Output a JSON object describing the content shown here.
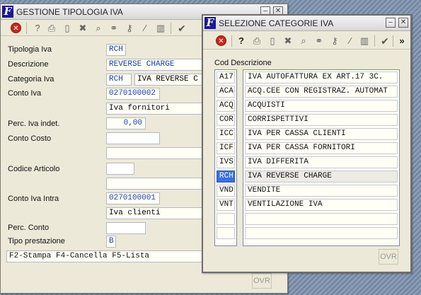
{
  "main_window": {
    "title": "GESTIONE TIPOLOGIA IVA",
    "form": {
      "tipologia": {
        "label": "Tipologia Iva",
        "value": "RCH"
      },
      "descrizione": {
        "label": "Descrizione",
        "value": "REVERSE CHARGE"
      },
      "categoria": {
        "label": "Categoria Iva",
        "code": "RCH",
        "desc": "IVA REVERSE C"
      },
      "conto_iva": {
        "label": "Conto Iva",
        "code": "0270100002",
        "desc": "Iva fornitori"
      },
      "perc_indet": {
        "label": "Perc. Iva indet.",
        "value": "0,00"
      },
      "conto_costo": {
        "label": "Conto Costo",
        "code": "",
        "desc": ""
      },
      "codice_articolo": {
        "label": "Codice Articolo",
        "code": "",
        "desc": ""
      },
      "conto_intra": {
        "label": "Conto Iva Intra",
        "code": "0270100001",
        "desc": "Iva clienti"
      },
      "perc_conto": {
        "label": "Perc. Conto",
        "value": ""
      },
      "tipo_prestazione": {
        "label": "Tipo prestazione",
        "value": "B"
      }
    },
    "status_text": "F2-Stampa F4-Cancella F5-Lista",
    "ovr_label": "OVR"
  },
  "popup": {
    "title": "SELEZIONE CATEGORIE IVA",
    "header_label": "Cod Descrizione",
    "rows": [
      {
        "code": "A17",
        "desc": "IVA AUTOFATTURA EX ART.17 3C."
      },
      {
        "code": "ACA",
        "desc": "ACQ.CEE CON REGISTRAZ. AUTOMAT"
      },
      {
        "code": "ACQ",
        "desc": "ACQUISTI"
      },
      {
        "code": "COR",
        "desc": "CORRISPETTIVI"
      },
      {
        "code": "ICC",
        "desc": "IVA PER CASSA CLIENTI"
      },
      {
        "code": "ICF",
        "desc": "IVA PER CASSA FORNITORI"
      },
      {
        "code": "IVS",
        "desc": "IVA DIFFERITA"
      },
      {
        "code": "RCH",
        "desc": "IVA REVERSE CHARGE"
      },
      {
        "code": "VND",
        "desc": "VENDITE"
      },
      {
        "code": "VNT",
        "desc": "VENTILAZIONE IVA"
      },
      {
        "code": "",
        "desc": ""
      },
      {
        "code": "",
        "desc": ""
      }
    ],
    "selected_index": 7,
    "more_label": "»",
    "ovr_label": "OVR"
  },
  "icons": {
    "logo": "F",
    "close_circle": "✕",
    "help": "?",
    "print": "⎙",
    "new_doc": "▯",
    "delete": "✖",
    "search": "⌕",
    "binoculars": "⚭",
    "key": "⚷",
    "magic_wand": "⁄",
    "columns": "▥",
    "confirm": "✔",
    "minimize": "–",
    "close": "✕"
  },
  "colors": {
    "selection": "#3a6fe0",
    "field_text_blue": "#1a3cb0",
    "logo_bg": "#1a1a8c",
    "stop_red": "#c8281c"
  }
}
